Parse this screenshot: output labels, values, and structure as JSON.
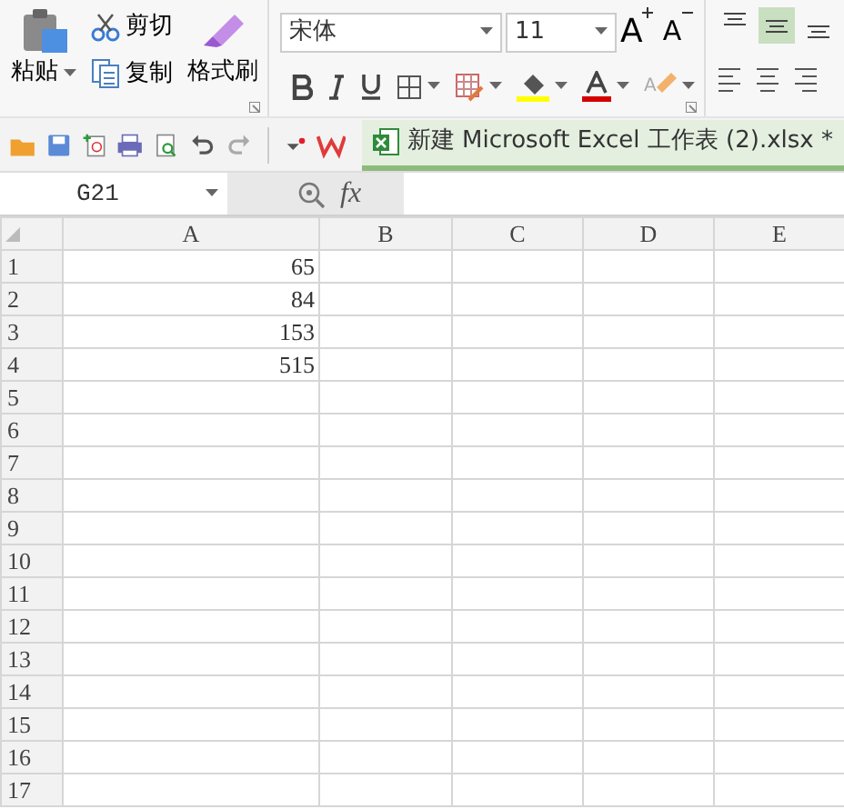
{
  "ribbon": {
    "clipboard": {
      "paste": "粘贴",
      "cut": "剪切",
      "copy": "复制",
      "format_painter": "格式刷"
    },
    "font": {
      "name": "宋体",
      "size": "11",
      "grow_font": "A",
      "shrink_font": "A",
      "clear_format": "A"
    },
    "align_top": [
      {
        "selected": false
      },
      {
        "selected": true
      },
      {
        "selected": false
      }
    ]
  },
  "quick_access": {
    "document_tab": {
      "title": "新建 Microsoft Excel 工作表 (2).xlsx *",
      "selected": true
    }
  },
  "formula_bar": {
    "name_box": "G21",
    "function_label": "fx"
  },
  "sheet": {
    "columns": [
      "A",
      "B",
      "C",
      "D",
      "E"
    ],
    "rows": [
      {
        "number": "1",
        "values": [
          "65"
        ]
      },
      {
        "number": "2",
        "values": [
          "84"
        ]
      },
      {
        "number": "3",
        "values": [
          "153"
        ]
      },
      {
        "number": "4",
        "values": [
          "515"
        ]
      },
      {
        "number": "5"
      },
      {
        "number": "6"
      },
      {
        "number": "7"
      },
      {
        "number": "8"
      },
      {
        "number": "9"
      },
      {
        "number": "10"
      },
      {
        "number": "11"
      },
      {
        "number": "12"
      },
      {
        "number": "13"
      },
      {
        "number": "14"
      },
      {
        "number": "15"
      },
      {
        "number": "16"
      },
      {
        "number": "17"
      }
    ]
  }
}
